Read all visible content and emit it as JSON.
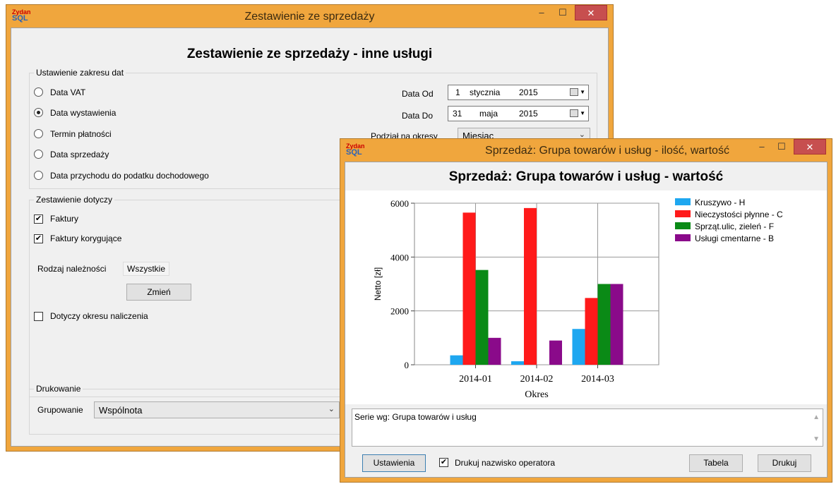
{
  "main_window": {
    "title": "Zestawienie ze sprzedaży",
    "heading": "Zestawienie ze sprzedaży - inne usługi",
    "app_icon_top": "Zydan",
    "app_icon_bottom": "SQL",
    "minimize": "–",
    "maximize": "☐",
    "close": "✕",
    "date_range": {
      "legend": "Ustawienie zakresu dat",
      "options": [
        "Data VAT",
        "Data wystawienia",
        "Termin płatności",
        "Data sprzedaży",
        "Data przychodu do podatku dochodowego"
      ],
      "selected_index": 1,
      "from_label": "Data Od",
      "from_day": "1",
      "from_month": "stycznia",
      "from_year": "2015",
      "to_label": "Data Do",
      "to_day": "31",
      "to_month": "maja",
      "to_year": "2015",
      "period_label": "Podział na okresy",
      "period_value": "Miesiąc"
    },
    "scope": {
      "legend": "Zestawienie dotyczy",
      "invoices": "Faktury",
      "invoices_checked": true,
      "corrections": "Faktury korygujące",
      "corrections_checked": true,
      "receivable_label": "Rodzaj należności",
      "receivable_value": "Wszystkie",
      "change_button": "Zmień",
      "accrual": "Dotyczy okresu naliczenia",
      "accrual_checked": false
    },
    "printing": {
      "legend": "Drukowanie",
      "grouping_label": "Grupowanie",
      "grouping_value": "Wspólnota"
    }
  },
  "chart_window": {
    "title": "Sprzedaż: Grupa towarów i usług - ilość, wartość",
    "minimize": "–",
    "maximize": "☐",
    "close": "✕",
    "series_info": "Serie wg: Grupa towarów i usług",
    "settings_button": "Ustawienia",
    "print_operator": "Drukuj nazwisko operatora",
    "print_operator_checked": true,
    "table_button": "Tabela",
    "print_button": "Drukuj"
  },
  "chart_data": {
    "type": "bar",
    "title": "Sprzedaż: Grupa towarów i usług - wartość",
    "xlabel": "Okres",
    "ylabel": "Netto [zł]",
    "categories": [
      "2014-01",
      "2014-02",
      "2014-03"
    ],
    "ylim": [
      0,
      6000
    ],
    "yticks": [
      "0",
      "2000",
      "4000",
      "6000"
    ],
    "grid": true,
    "legend_position": "right",
    "series": [
      {
        "name": "Kruszywo - H",
        "color": "#1ea7f0",
        "values": [
          350,
          130,
          1330
        ]
      },
      {
        "name": "Nieczystości płynne - C",
        "color": "#ff1a1a",
        "values": [
          5650,
          5820,
          2480
        ]
      },
      {
        "name": "Sprząt.ulic, zieleń - F",
        "color": "#0a8a16",
        "values": [
          3520,
          0,
          3000
        ]
      },
      {
        "name": "Usługi cmentarne - B",
        "color": "#8a0a8a",
        "values": [
          1000,
          900,
          3000
        ]
      }
    ]
  }
}
